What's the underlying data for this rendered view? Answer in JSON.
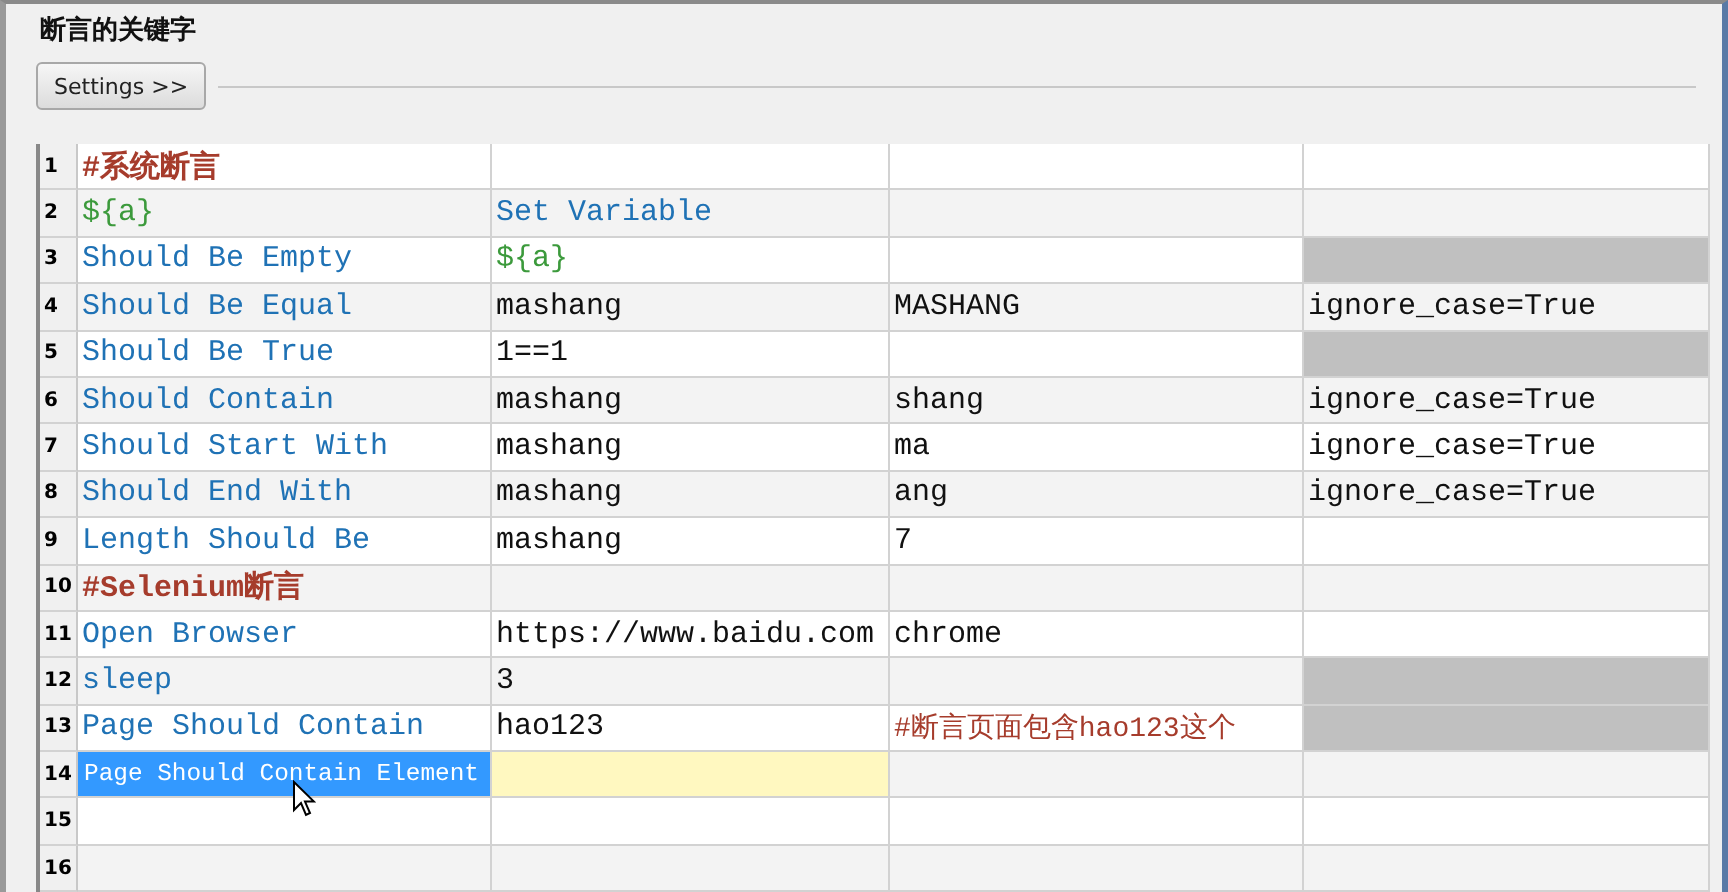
{
  "panel": {
    "title": "断言的关键字",
    "settings_button": "Settings >>"
  },
  "grid": {
    "rows": [
      {
        "number": "1",
        "cells": [
          {
            "text": "#系统断言",
            "kind": "comment",
            "selected": false
          },
          {
            "kind": "empty",
            "selected": false
          },
          {
            "kind": "empty",
            "selected": false
          },
          {
            "kind": "empty",
            "selected": false
          }
        ]
      },
      {
        "number": "2",
        "cells": [
          {
            "text": "${a}",
            "kind": "variable",
            "selected": false
          },
          {
            "text": "Set Variable",
            "kind": "keyword",
            "selected": false
          },
          {
            "kind": "empty",
            "selected": false
          },
          {
            "kind": "empty",
            "selected": false
          }
        ]
      },
      {
        "number": "3",
        "cells": [
          {
            "text": "Should Be Empty",
            "kind": "keyword",
            "selected": false
          },
          {
            "text": "${a}",
            "kind": "variable",
            "selected": false
          },
          {
            "kind": "empty",
            "selected": false
          },
          {
            "kind": "blocked",
            "selected": false
          }
        ]
      },
      {
        "number": "4",
        "cells": [
          {
            "text": "Should Be Equal",
            "kind": "keyword",
            "selected": false
          },
          {
            "text": "mashang",
            "kind": "plain",
            "selected": false
          },
          {
            "text": "MASHANG",
            "kind": "plain",
            "selected": false
          },
          {
            "text": "ignore_case=True",
            "kind": "plain",
            "selected": false
          }
        ]
      },
      {
        "number": "5",
        "cells": [
          {
            "text": "Should Be True",
            "kind": "keyword",
            "selected": false
          },
          {
            "text": "1==1",
            "kind": "plain",
            "selected": false
          },
          {
            "kind": "empty",
            "selected": false
          },
          {
            "kind": "blocked",
            "selected": false
          }
        ]
      },
      {
        "number": "6",
        "cells": [
          {
            "text": "Should Contain",
            "kind": "keyword",
            "selected": false
          },
          {
            "text": "mashang",
            "kind": "plain",
            "selected": false
          },
          {
            "text": "shang",
            "kind": "plain",
            "selected": false
          },
          {
            "text": "ignore_case=True",
            "kind": "plain",
            "selected": false
          }
        ]
      },
      {
        "number": "7",
        "cells": [
          {
            "text": "Should Start With",
            "kind": "keyword",
            "selected": false
          },
          {
            "text": "mashang",
            "kind": "plain",
            "selected": false
          },
          {
            "text": "ma",
            "kind": "plain",
            "selected": false
          },
          {
            "text": "ignore_case=True",
            "kind": "plain",
            "selected": false
          }
        ]
      },
      {
        "number": "8",
        "cells": [
          {
            "text": "Should End With",
            "kind": "keyword",
            "selected": false
          },
          {
            "text": "mashang",
            "kind": "plain",
            "selected": false
          },
          {
            "text": "ang",
            "kind": "plain",
            "selected": false
          },
          {
            "text": "ignore_case=True",
            "kind": "plain",
            "selected": false
          }
        ]
      },
      {
        "number": "9",
        "cells": [
          {
            "text": "Length Should Be",
            "kind": "keyword",
            "selected": false
          },
          {
            "text": "mashang",
            "kind": "plain",
            "selected": false
          },
          {
            "text": "7",
            "kind": "plain",
            "selected": false
          },
          {
            "kind": "empty",
            "selected": false
          }
        ]
      },
      {
        "number": "10",
        "cells": [
          {
            "text": "#Selenium断言",
            "kind": "comment",
            "selected": false
          },
          {
            "kind": "empty",
            "selected": false
          },
          {
            "kind": "empty",
            "selected": false
          },
          {
            "kind": "empty",
            "selected": false
          }
        ]
      },
      {
        "number": "11",
        "cells": [
          {
            "text": "Open Browser",
            "kind": "keyword",
            "selected": false
          },
          {
            "text": "https://www.baidu.com",
            "kind": "plain",
            "selected": false
          },
          {
            "text": "chrome",
            "kind": "plain",
            "selected": false
          },
          {
            "kind": "empty",
            "selected": false
          }
        ]
      },
      {
        "number": "12",
        "cells": [
          {
            "text": "sleep",
            "kind": "keyword",
            "selected": false
          },
          {
            "text": "3",
            "kind": "plain",
            "selected": false
          },
          {
            "kind": "empty",
            "selected": false
          },
          {
            "kind": "blocked",
            "selected": false
          }
        ]
      },
      {
        "number": "13",
        "cells": [
          {
            "text": "Page Should Contain",
            "kind": "keyword",
            "selected": false
          },
          {
            "text": "hao123",
            "kind": "plain",
            "selected": false
          },
          {
            "text": "#断言页面包含hao123这个",
            "kind": "note",
            "selected": false
          },
          {
            "kind": "blocked",
            "selected": false
          }
        ]
      },
      {
        "number": "14",
        "cells": [
          {
            "text": "Page Should Contain Element",
            "kind": "keyword",
            "selected": true
          },
          {
            "kind": "expected",
            "selected": false
          },
          {
            "kind": "empty",
            "selected": false
          },
          {
            "kind": "empty",
            "selected": false
          }
        ]
      },
      {
        "number": "15",
        "cells": [
          {
            "kind": "empty",
            "selected": false
          },
          {
            "kind": "empty",
            "selected": false
          },
          {
            "kind": "empty",
            "selected": false
          },
          {
            "kind": "empty",
            "selected": false
          }
        ]
      },
      {
        "number": "16",
        "cells": [
          {
            "kind": "empty",
            "selected": false
          },
          {
            "kind": "empty",
            "selected": false
          },
          {
            "kind": "empty",
            "selected": false
          },
          {
            "kind": "empty",
            "selected": false
          }
        ]
      }
    ]
  }
}
